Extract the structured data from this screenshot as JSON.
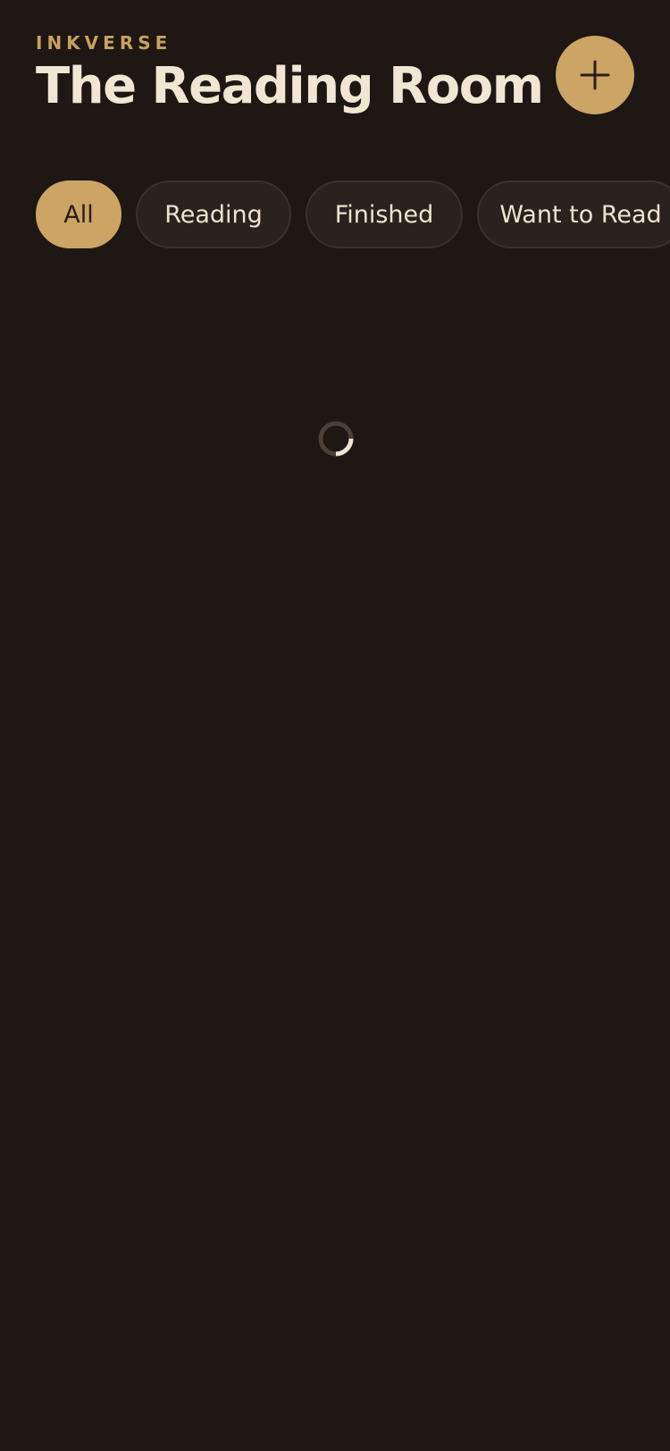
{
  "header": {
    "brand": "INKVERSE",
    "title": "The Reading Room",
    "add_icon": "plus-icon"
  },
  "filters": {
    "items": [
      {
        "label": "All",
        "active": true
      },
      {
        "label": "Reading",
        "active": false
      },
      {
        "label": "Finished",
        "active": false
      },
      {
        "label": "Want to Read",
        "active": false
      }
    ]
  },
  "loading": {
    "icon": "loading-spinner-icon"
  },
  "colors": {
    "background": "#1e1714",
    "accent": "#cca464",
    "brand_text": "#c9a15f",
    "title_text": "#f1e6d2",
    "chip_background": "#2a221d",
    "chip_border": "#3b3028",
    "chip_text": "#efe3cf",
    "spinner_track": "#4b4037",
    "spinner_arc": "#f1e6d2"
  }
}
